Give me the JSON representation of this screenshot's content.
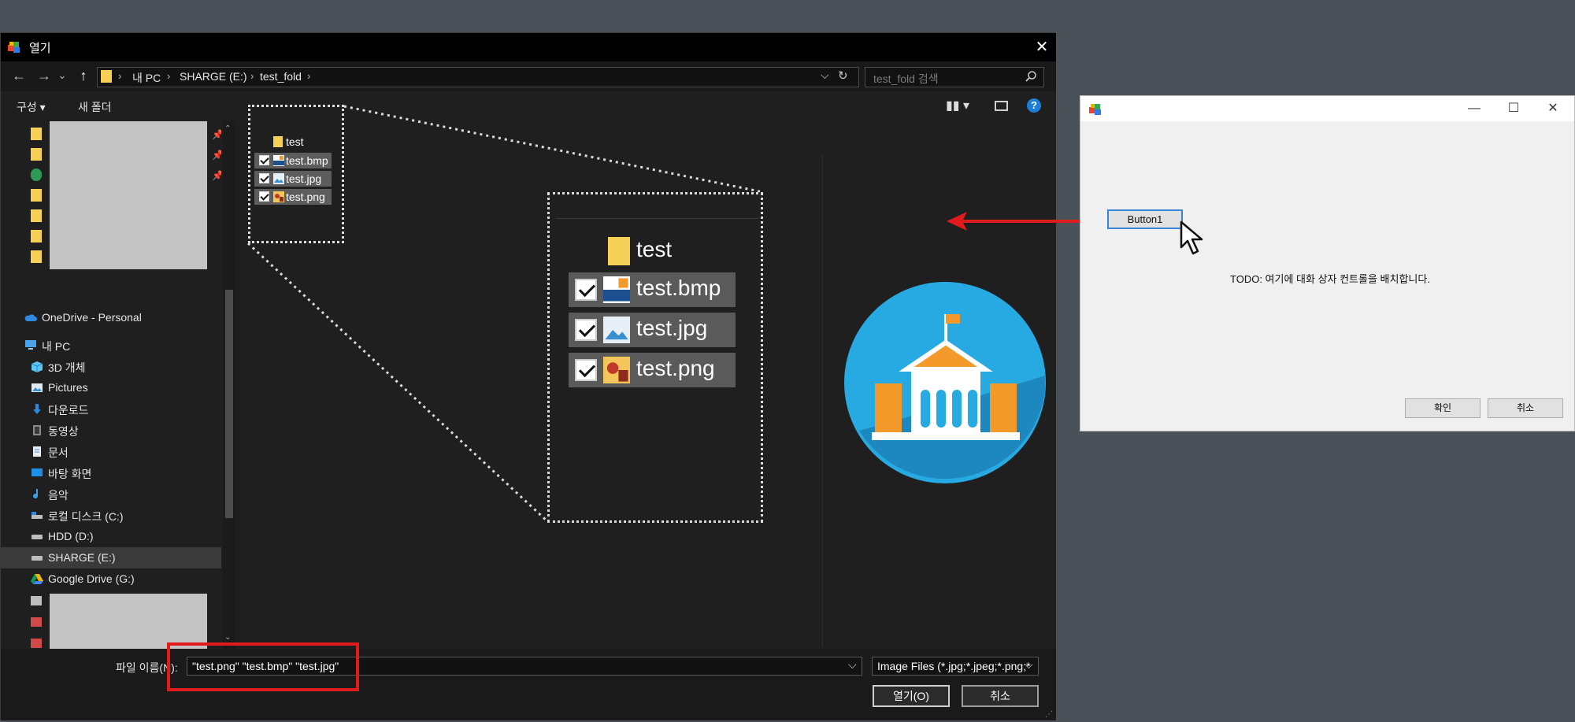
{
  "open_dialog": {
    "title": "열기",
    "close_glyph": "✕",
    "nav": {
      "back": "←",
      "forward": "→",
      "recent": "⌄",
      "up": "↑"
    },
    "breadcrumbs": [
      "내 PC",
      "SHARGE (E:)",
      "test_fold"
    ],
    "search_placeholder": "test_fold 검색",
    "toolbar": {
      "organize": "구성 ▾",
      "new_folder": "새 폴더",
      "help": "?"
    },
    "nav_pane": {
      "onedrive": "OneDrive - Personal",
      "this_pc": "내 PC",
      "items": [
        {
          "label": "3D 개체",
          "icon": "cube-icon"
        },
        {
          "label": "Pictures",
          "icon": "pictures-icon"
        },
        {
          "label": "다운로드",
          "icon": "download-icon"
        },
        {
          "label": "동영상",
          "icon": "video-icon"
        },
        {
          "label": "문서",
          "icon": "document-icon"
        },
        {
          "label": "바탕 화면",
          "icon": "desktop-icon"
        },
        {
          "label": "음악",
          "icon": "music-icon"
        },
        {
          "label": "로컬 디스크 (C:)",
          "icon": "drive-icon"
        },
        {
          "label": "HDD (D:)",
          "icon": "drive-icon"
        },
        {
          "label": "SHARGE (E:)",
          "icon": "drive-icon",
          "selected": true
        },
        {
          "label": "Google Drive (G:)",
          "icon": "google-drive-icon"
        }
      ],
      "partial_label": "SH"
    },
    "files": [
      {
        "name": "test",
        "type": "folder",
        "selected": false
      },
      {
        "name": "test.bmp",
        "type": "bmp",
        "selected": true
      },
      {
        "name": "test.jpg",
        "type": "jpg",
        "selected": true
      },
      {
        "name": "test.png",
        "type": "png",
        "selected": true
      }
    ],
    "filename_label": "파일 이름(N):",
    "filename_value": "\"test.png\" \"test.bmp\" \"test.jpg\"",
    "filetype_value": "Image Files (*.jpg;*.jpeg;*.png;*",
    "open_button": "열기(O)",
    "cancel_button": "취소"
  },
  "sample_dialog": {
    "button1": "Button1",
    "todo_text": "TODO: 여기에 대화 상자 컨트롤을 배치합니다.",
    "ok_button": "확인",
    "cancel_button": "취소",
    "minimize": "—",
    "maximize": "☐",
    "close": "✕"
  },
  "colors": {
    "annotation_red": "#e01b1b",
    "folder_yellow": "#f6cf57",
    "accent_blue": "#1a7fd6",
    "preview_circle": "#27a9e1"
  }
}
